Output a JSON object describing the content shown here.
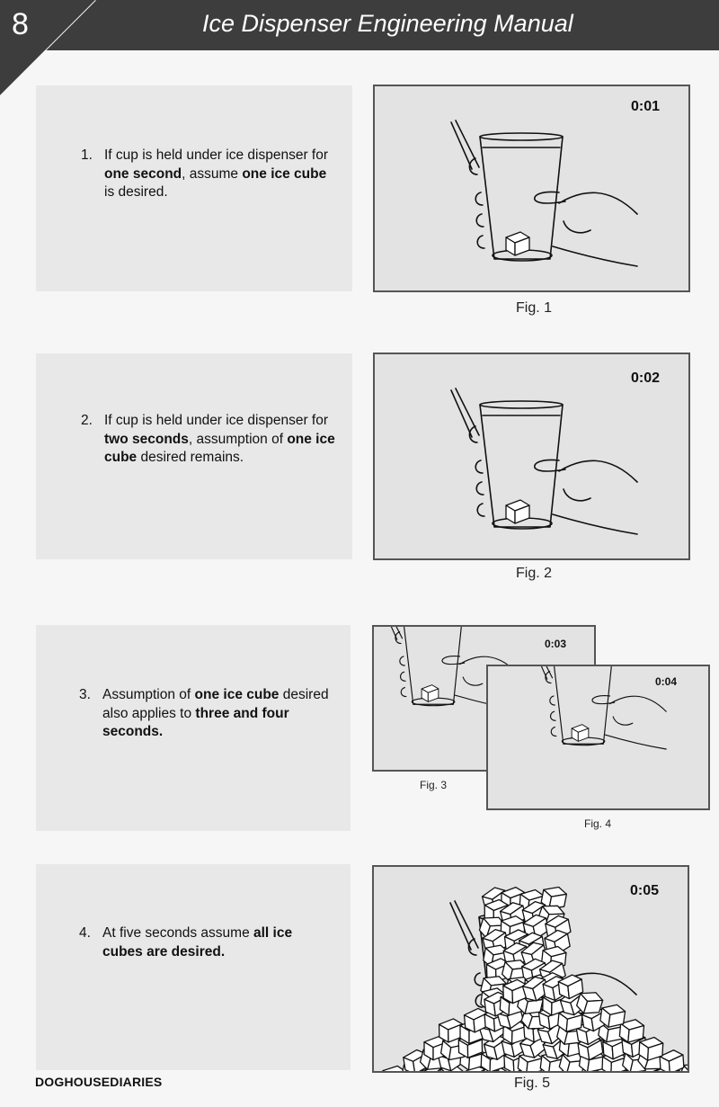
{
  "header": {
    "page_number": "8",
    "title": "Ice Dispenser Engineering Manual"
  },
  "steps": [
    {
      "number": "1.",
      "parts": [
        {
          "text": "If cup is held under ice dispenser for ",
          "bold": false
        },
        {
          "text": "one second",
          "bold": true
        },
        {
          "text": ", assume ",
          "bold": false
        },
        {
          "text": "one ice cube",
          "bold": true
        },
        {
          "text": " is desired.",
          "bold": false
        }
      ]
    },
    {
      "number": "2.",
      "parts": [
        {
          "text": "If cup is held under ice dispenser for ",
          "bold": false
        },
        {
          "text": "two seconds",
          "bold": true
        },
        {
          "text": ", assumption of ",
          "bold": false
        },
        {
          "text": "one ice cube",
          "bold": true
        },
        {
          "text": " desired remains.",
          "bold": false
        }
      ]
    },
    {
      "number": "3.",
      "parts": [
        {
          "text": "Assumption of ",
          "bold": false
        },
        {
          "text": "one ice cube",
          "bold": true
        },
        {
          "text": " desired also applies to ",
          "bold": false
        },
        {
          "text": "three and four seconds.",
          "bold": true
        }
      ]
    },
    {
      "number": "4.",
      "parts": [
        {
          "text": "At five seconds assume ",
          "bold": false
        },
        {
          "text": "all ice cubes are desired.",
          "bold": true
        }
      ]
    }
  ],
  "figures": [
    {
      "timer": "0:01",
      "caption": "Fig. 1"
    },
    {
      "timer": "0:02",
      "caption": "Fig. 2"
    },
    {
      "timer": "0:03",
      "caption": "Fig. 3"
    },
    {
      "timer": "0:04",
      "caption": "Fig. 4"
    },
    {
      "timer": "0:05",
      "caption": "Fig. 5"
    }
  ],
  "footer": {
    "credit": "DOGHOUSEDIARIES"
  }
}
